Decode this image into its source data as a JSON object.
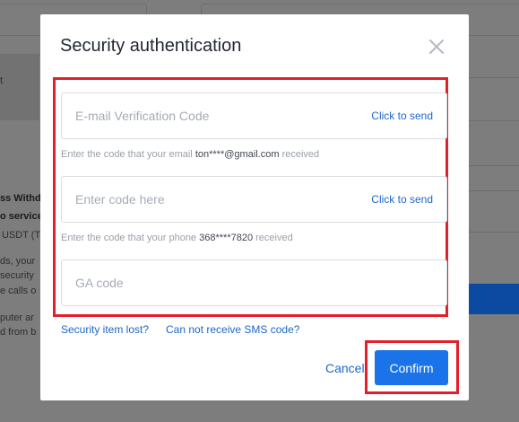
{
  "background": {
    "texts": [
      "t",
      "ss Withd",
      "o service",
      "USDT (T",
      "ds, your",
      "security",
      "e calls o",
      "puter ar",
      "d from b"
    ]
  },
  "modal": {
    "title": "Security authentication",
    "email": {
      "placeholder": "E-mail Verification Code",
      "send_label": "Click to send",
      "hint_prefix": "Enter the code that your email",
      "hint_value": "ton****@gmail.com",
      "hint_suffix": "received"
    },
    "phone": {
      "placeholder": "Enter code here",
      "send_label": "Click to send",
      "hint_prefix": "Enter the code that your phone",
      "hint_value": "368****7820",
      "hint_suffix": "received"
    },
    "ga": {
      "placeholder": "GA code"
    },
    "links": {
      "security_lost": "Security item lost?",
      "no_sms": "Can not receive SMS code?"
    },
    "cancel_label": "Cancel",
    "confirm_label": "Confirm"
  },
  "colors": {
    "accent": "#1a73e8",
    "link": "#1e66c8",
    "highlight": "#e2202b"
  }
}
